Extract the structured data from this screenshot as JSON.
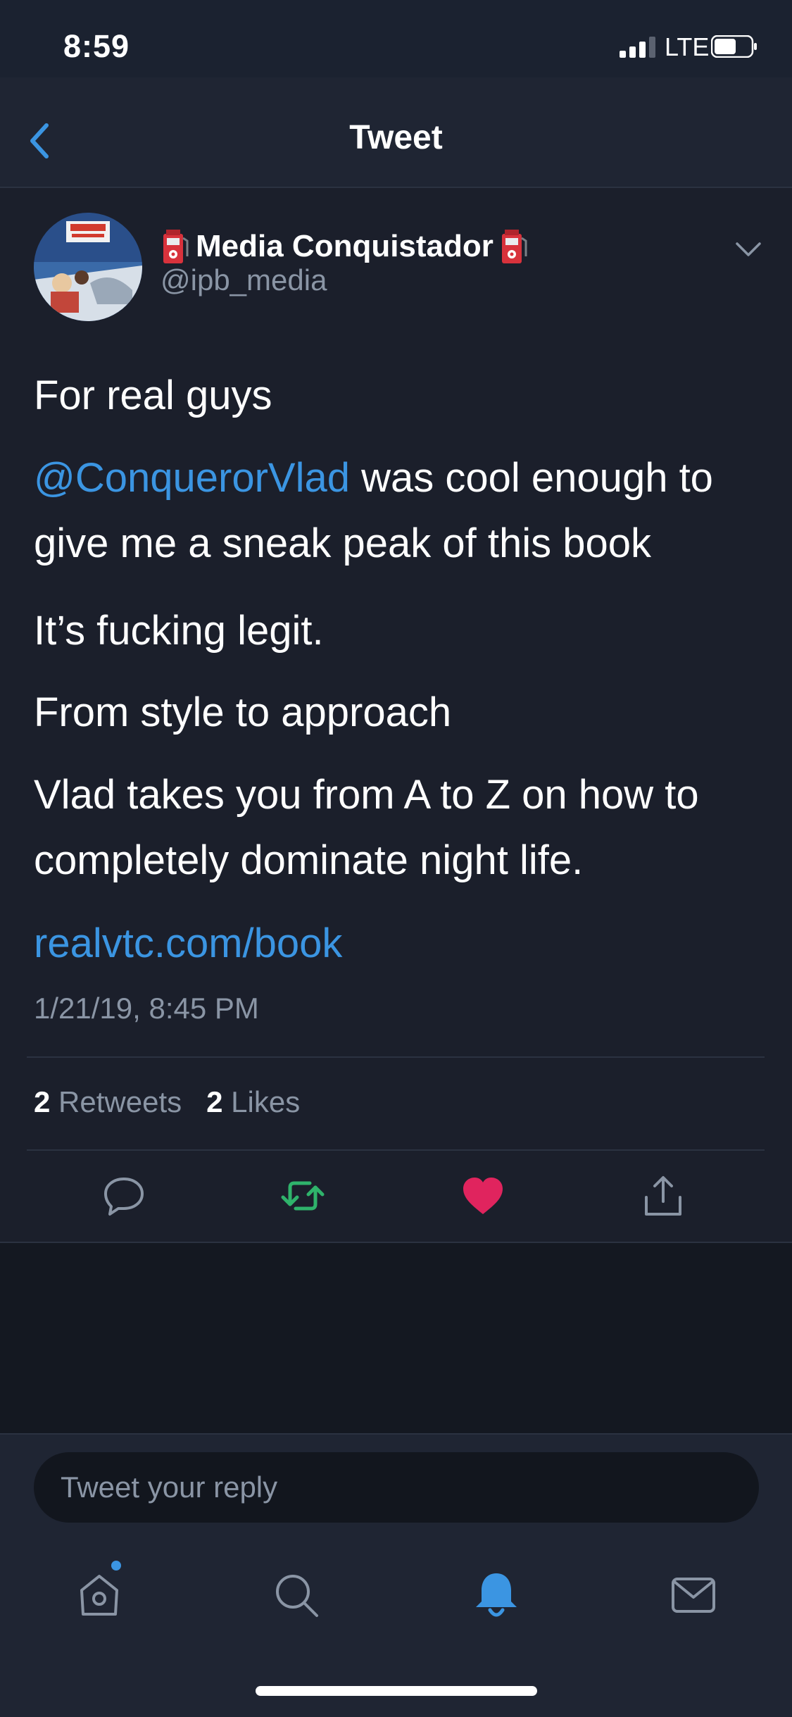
{
  "status_bar": {
    "time": "8:59",
    "network": "LTE"
  },
  "header": {
    "title": "Tweet"
  },
  "tweet": {
    "author_name": "Media Conquistador",
    "author_handle": "@ipb_media",
    "line1": "For real guys",
    "mention": "@ConquerorVlad",
    "line2_rest": " was cool enough to",
    "line3": "give me a sneak peak of this book",
    "line4": "It’s fucking legit.",
    "line5": "From style to approach",
    "line6": "Vlad takes you from A to Z on how to",
    "line7": "completely dominate night life.",
    "link": "realvtc.com/book",
    "timestamp": "1/21/19, 8:45 PM",
    "retweet_count": "2",
    "retweet_label": "Retweets",
    "like_count": "2",
    "like_label": "Likes"
  },
  "reply": {
    "placeholder": "Tweet your reply"
  },
  "colors": {
    "accent": "#3b95e2",
    "retweet": "#2fb36b",
    "like": "#e0245e"
  },
  "icons": [
    "back-chevron",
    "down-chevron",
    "reply",
    "retweet",
    "like",
    "share",
    "home",
    "search",
    "notifications",
    "messages"
  ]
}
